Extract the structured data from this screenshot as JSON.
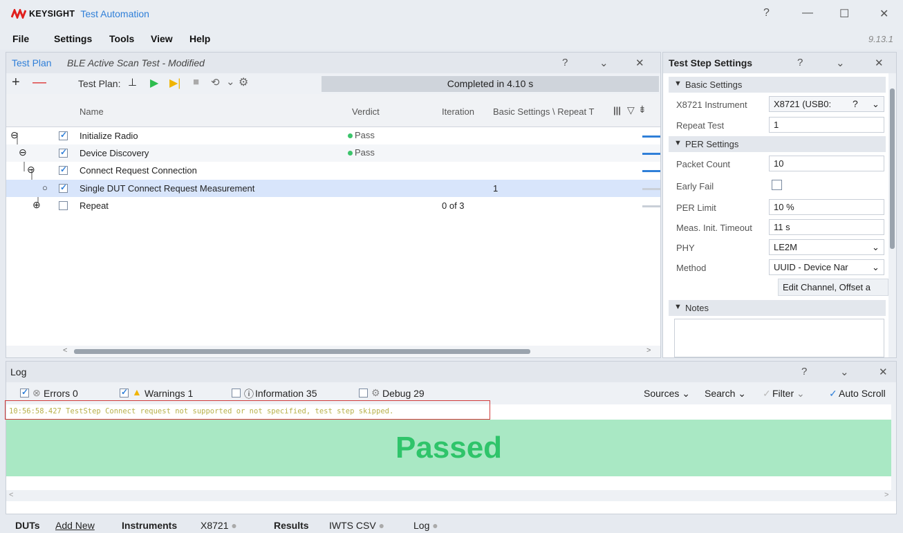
{
  "app": {
    "brand": "KEYSIGHT",
    "title": "Test Automation",
    "version": "9.13.1"
  },
  "window": {
    "help": "?",
    "minimize": "—",
    "maximize": "☐",
    "close": "✕"
  },
  "menu": [
    "File",
    "Settings",
    "Tools",
    "View",
    "Help"
  ],
  "test_plan": {
    "title_prefix": "Test Plan",
    "title_name": "BLE Active Scan Test - Modified",
    "toolbar_label": "Test Plan:",
    "status": "Completed in 4.10 s",
    "columns": {
      "name": "Name",
      "verdict": "Verdict",
      "iteration": "Iteration",
      "repeat": "Basic Settings \\ Repeat T"
    },
    "rows": [
      {
        "name": "Initialize Radio",
        "verdict": "Pass",
        "iteration": "",
        "repeat": "",
        "checked": true
      },
      {
        "name": "Device Discovery",
        "verdict": "Pass",
        "iteration": "",
        "repeat": "",
        "checked": true
      },
      {
        "name": "Connect Request Connection",
        "verdict": "",
        "iteration": "",
        "repeat": "",
        "checked": true
      },
      {
        "name": "Single DUT Connect Request Measurement",
        "verdict": "",
        "iteration": "",
        "repeat": "1",
        "checked": true
      },
      {
        "name": "Repeat",
        "verdict": "",
        "iteration": "0 of 3",
        "repeat": "",
        "checked": false
      }
    ],
    "colors": {
      "accent": "#2f7fd8",
      "pass": "#3cc46b"
    }
  },
  "step_settings": {
    "title": "Test Step Settings",
    "basic_header": "Basic Settings",
    "per_header": "PER Settings",
    "notes_header": "Notes",
    "fields": {
      "instrument_label": "X8721 Instrument",
      "instrument_value": "X8721 (USB0:",
      "instrument_q": "?",
      "repeat_label": "Repeat Test",
      "repeat_value": "1",
      "packet_label": "Packet Count",
      "packet_value": "10",
      "earlyfail_label": "Early Fail",
      "perlimit_label": "PER Limit",
      "perlimit_value": "10 %",
      "timeout_label": "Meas. Init. Timeout",
      "timeout_value": "11 s",
      "phy_label": "PHY",
      "phy_value": "LE2M",
      "method_label": "Method",
      "method_value": "UUID - Device Nar",
      "edit_button": "Edit Channel, Offset a"
    }
  },
  "log": {
    "title": "Log",
    "errors": "Errors 0",
    "warnings": "Warnings 1",
    "information": "Information 35",
    "debug": "Debug 29",
    "sources": "Sources",
    "search": "Search",
    "filter": "Filter",
    "autoscroll": "Auto Scroll",
    "line": "10:56:58.427  TestStep  Connect request not supported or not specified, test step skipped.",
    "banner": "Passed"
  },
  "statusbar": {
    "duts": "DUTs",
    "add_new": "Add New",
    "instruments": "Instruments",
    "instrument_name": "X8721",
    "results": "Results",
    "iwts": "IWTS CSV",
    "log": "Log"
  }
}
